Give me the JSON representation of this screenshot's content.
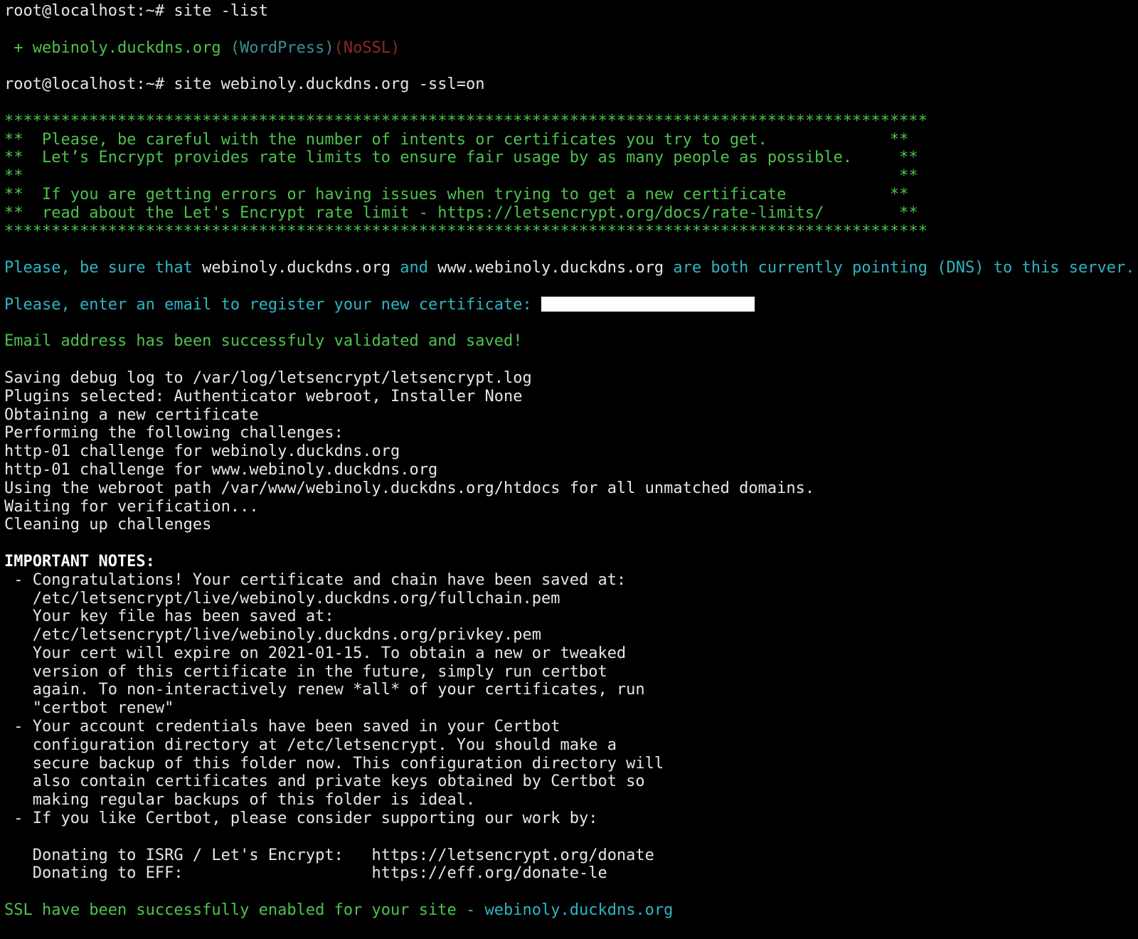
{
  "cmd1": {
    "prompt": "root@localhost:~#",
    "command": "site -list"
  },
  "site_list": {
    "bullet": "+",
    "domain": "webinoly.duckdns.org",
    "type": "(WordPress)",
    "ssl": "(NoSSL)"
  },
  "cmd2": {
    "prompt": "root@localhost:~#",
    "command": "site webinoly.duckdns.org -ssl=on"
  },
  "notice": {
    "border": "**************************************************************************************************",
    "lines": [
      "**  Please, be careful with the number of intents or certificates you try to get.             **",
      "**  Let’s Encrypt provides rate limits to ensure fair usage by as many people as possible.     **",
      "**                                                                                             **",
      "**  If you are getting errors or having issues when trying to get a new certificate           **",
      "**  read about the Let's Encrypt rate limit - https://letsencrypt.org/docs/rate-limits/        **"
    ]
  },
  "dns_notice": {
    "part1": "Please, be sure that ",
    "domain1": "webinoly.duckdns.org",
    "part2": " and ",
    "domain2": "www.webinoly.duckdns.org",
    "part3": " are both currently pointing (DNS) to this server."
  },
  "email_prompt": "Please, enter an email to register your new certificate: ",
  "email_validated": "Email address has been successfuly validated and saved!",
  "certbot_log": [
    "Saving debug log to /var/log/letsencrypt/letsencrypt.log",
    "Plugins selected: Authenticator webroot, Installer None",
    "Obtaining a new certificate",
    "Performing the following challenges:",
    "http-01 challenge for webinoly.duckdns.org",
    "http-01 challenge for www.webinoly.duckdns.org",
    "Using the webroot path /var/www/webinoly.duckdns.org/htdocs for all unmatched domains.",
    "Waiting for verification...",
    "Cleaning up challenges"
  ],
  "important_title": "IMPORTANT NOTES:",
  "important_lines": [
    " - Congratulations! Your certificate and chain have been saved at:",
    "   /etc/letsencrypt/live/webinoly.duckdns.org/fullchain.pem",
    "   Your key file has been saved at:",
    "   /etc/letsencrypt/live/webinoly.duckdns.org/privkey.pem",
    "   Your cert will expire on 2021-01-15. To obtain a new or tweaked",
    "   version of this certificate in the future, simply run certbot",
    "   again. To non-interactively renew *all* of your certificates, run",
    "   \"certbot renew\"",
    " - Your account credentials have been saved in your Certbot",
    "   configuration directory at /etc/letsencrypt. You should make a",
    "   secure backup of this folder now. This configuration directory will",
    "   also contain certificates and private keys obtained by Certbot so",
    "   making regular backups of this folder is ideal.",
    " - If you like Certbot, please consider supporting our work by:",
    "",
    "   Donating to ISRG / Let's Encrypt:   https://letsencrypt.org/donate",
    "   Donating to EFF:                    https://eff.org/donate-le"
  ],
  "ssl_success": {
    "text": "SSL have been successfully enabled for your site - ",
    "domain": "webinoly.duckdns.org"
  },
  "colors": {
    "background": "#000000",
    "text": "#e6e6e6",
    "green": "#4ec24e",
    "cyan": "#2fb4c4",
    "teal": "#3a8f96",
    "red": "#8c2a2a"
  }
}
